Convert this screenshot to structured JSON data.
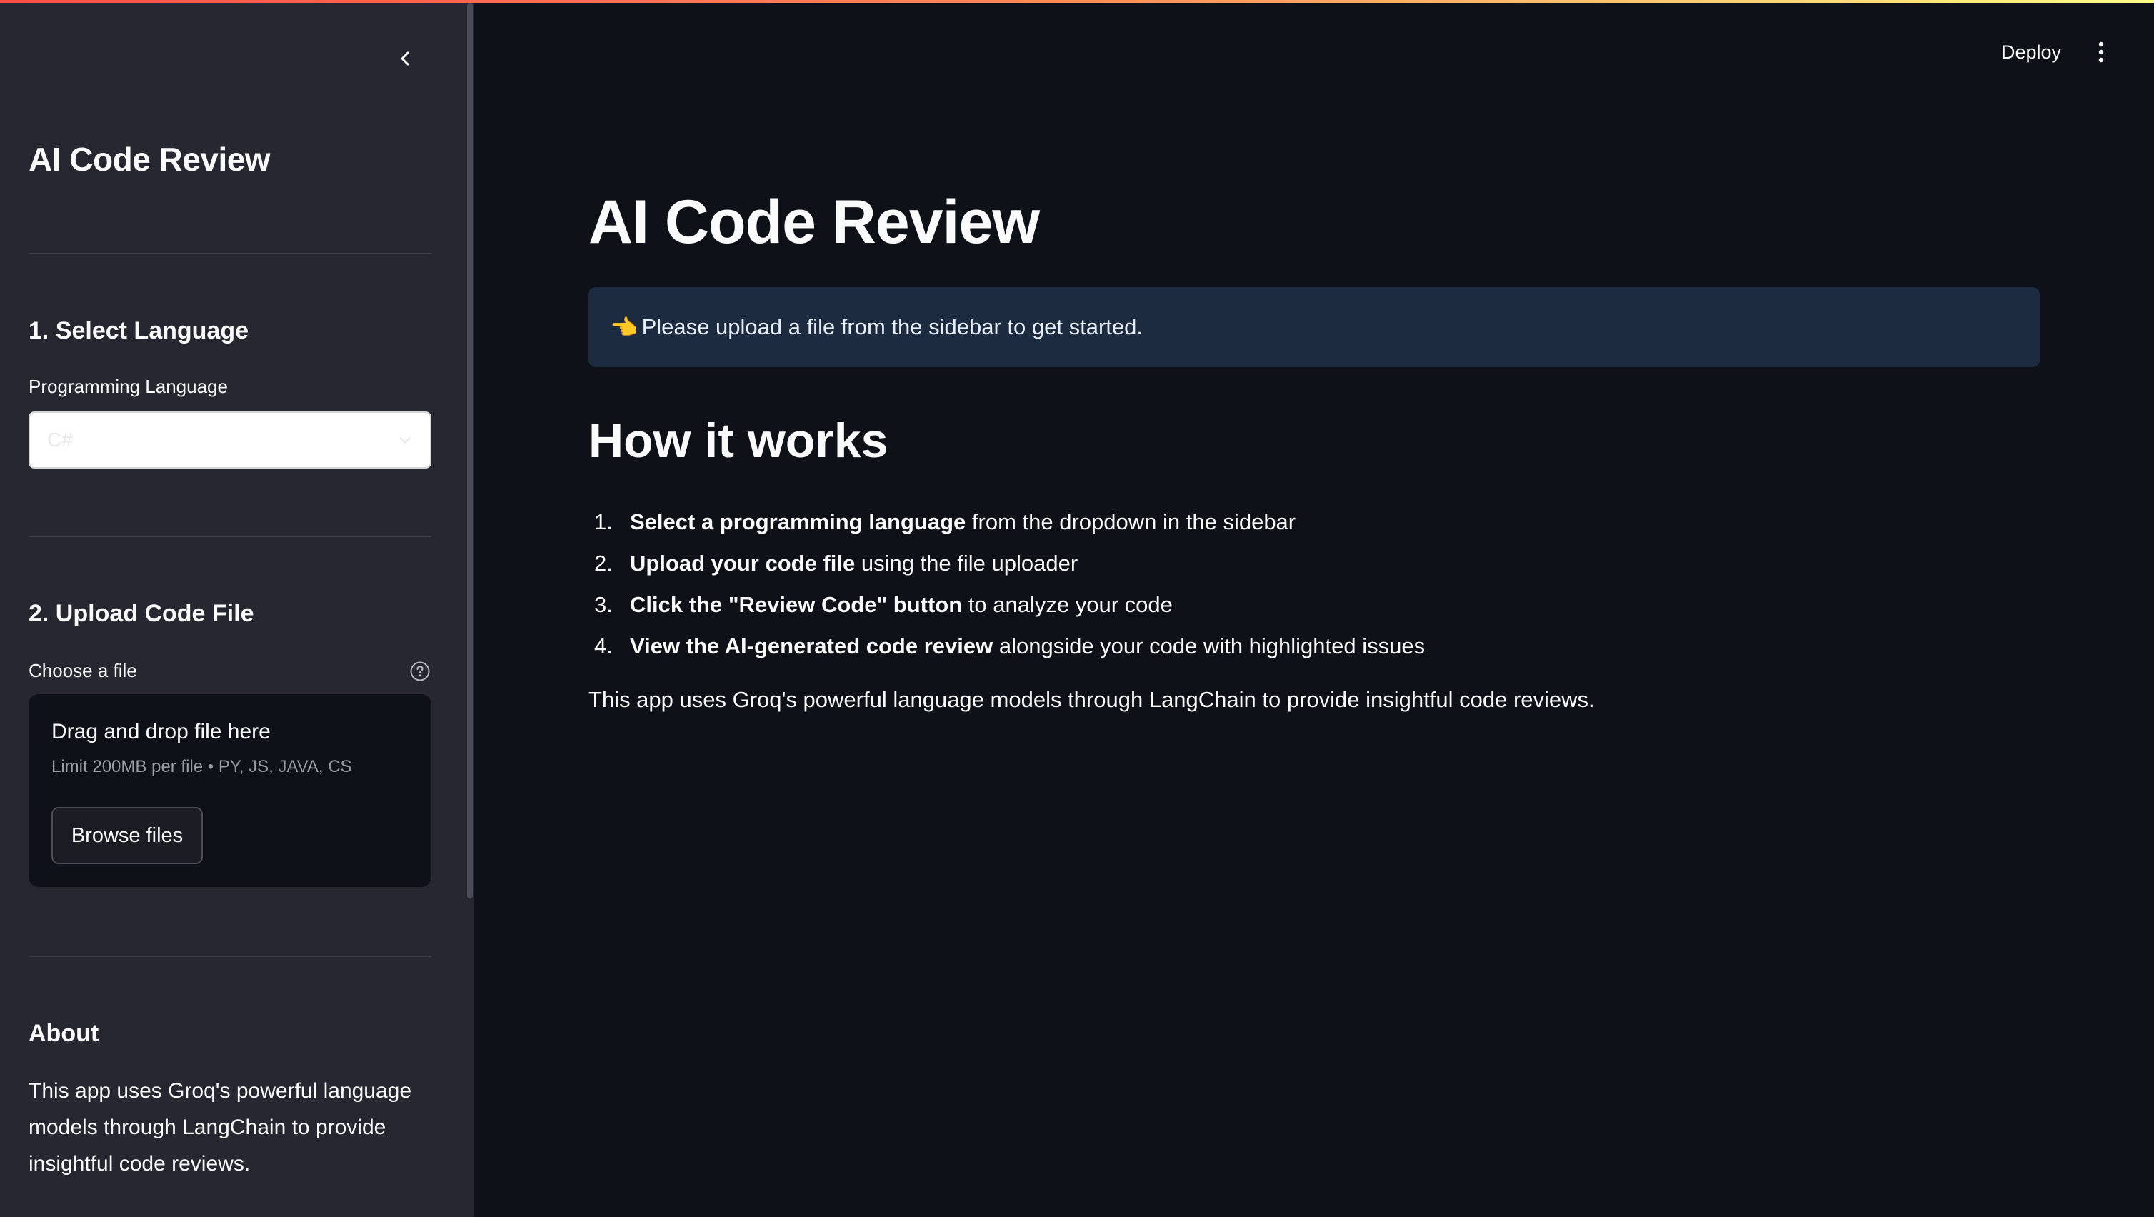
{
  "sidebar": {
    "title": "AI Code Review",
    "section1_heading": "1. Select Language",
    "language_label": "Programming Language",
    "language_selected": "C#",
    "section2_heading": "2. Upload Code File",
    "file_label": "Choose a file",
    "uploader": {
      "title": "Drag and drop file here",
      "subtitle": "Limit 200MB per file • PY, JS, JAVA, CS",
      "browse_label": "Browse files"
    },
    "about_heading": "About",
    "about_text": "This app uses Groq's powerful language models through LangChain to provide insightful code reviews."
  },
  "header": {
    "deploy_label": "Deploy"
  },
  "main": {
    "title": "AI Code Review",
    "info_emoji": "👈",
    "info_text": "Please upload a file from the sidebar to get started.",
    "how_heading": "How it works",
    "steps": [
      {
        "num": "1.",
        "bold": "Select a programming language",
        "rest": " from the dropdown in the sidebar"
      },
      {
        "num": "2.",
        "bold": "Upload your code file",
        "rest": " using the file uploader"
      },
      {
        "num": "3.",
        "bold": "Click the \"Review Code\" button",
        "rest": " to analyze your code"
      },
      {
        "num": "4.",
        "bold": "View the AI-generated code review",
        "rest": " alongside your code with highlighted issues"
      }
    ],
    "footer_text": "This app uses Groq's powerful language models through LangChain to provide insightful code reviews."
  },
  "colors": {
    "background": "#0e1117",
    "sidebar": "#262730",
    "info_bg": "#1c2b40",
    "accent_start": "#ff4b4b",
    "accent_end": "#fffd80"
  },
  "icons": [
    "chevron-left-icon",
    "chevron-down-icon",
    "help-circle-icon",
    "more-vertical-icon"
  ]
}
